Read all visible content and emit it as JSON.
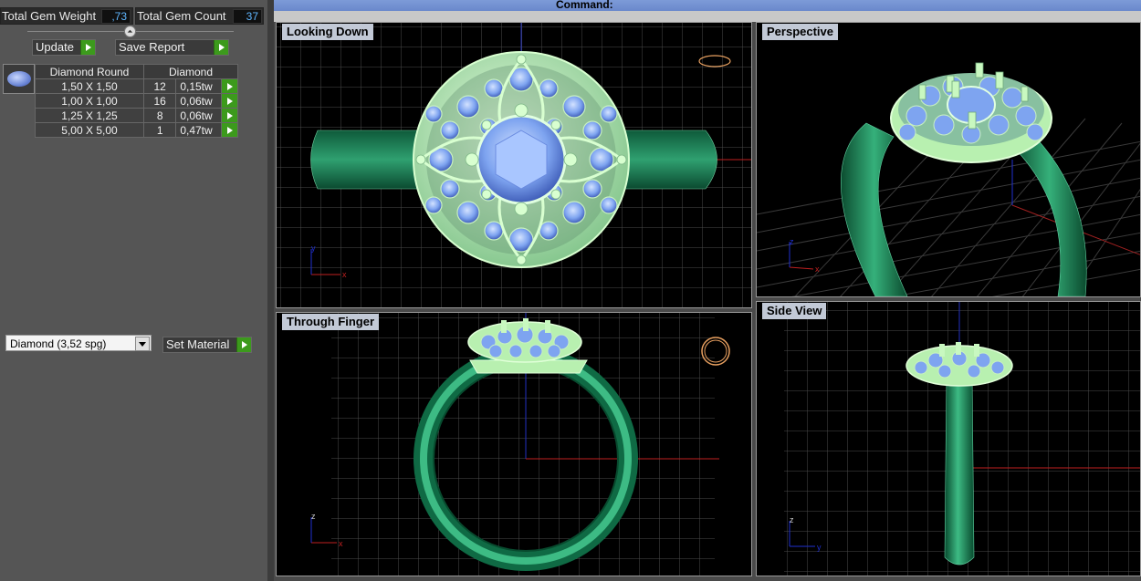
{
  "stats": {
    "total_gem_weight_label": "Total Gem Weight",
    "total_gem_weight_value": ",73",
    "total_gem_count_label": "Total Gem Count",
    "total_gem_count_value": "37"
  },
  "buttons": {
    "update": "Update",
    "save_report": "Save Report",
    "set_material": "Set Material"
  },
  "gem_table": {
    "header_shape": "Diamond Round",
    "header_material": "Diamond",
    "rows": [
      {
        "size": "1,50 X 1,50",
        "count": "12",
        "weight": "0,15tw"
      },
      {
        "size": "1,00 X 1,00",
        "count": "16",
        "weight": "0,06tw"
      },
      {
        "size": "1,25 X 1,25",
        "count": "8",
        "weight": "0,06tw"
      },
      {
        "size": "5,00 X 5,00",
        "count": "1",
        "weight": "0,47tw"
      }
    ]
  },
  "material_select": {
    "value": "Diamond    (3,52 spg)"
  },
  "command": {
    "label": "Command:"
  },
  "viewports": {
    "top_left": "Looking Down",
    "top_right": "Perspective",
    "bottom_left": "Through Finger",
    "bottom_right": "Side View"
  },
  "axes": {
    "y": "y",
    "x": "x",
    "z": "z"
  },
  "colors": {
    "metal": "#2e9a6a",
    "setting": "#b8f0b0",
    "stone": "#7ea4f0",
    "grid": "#555555"
  }
}
